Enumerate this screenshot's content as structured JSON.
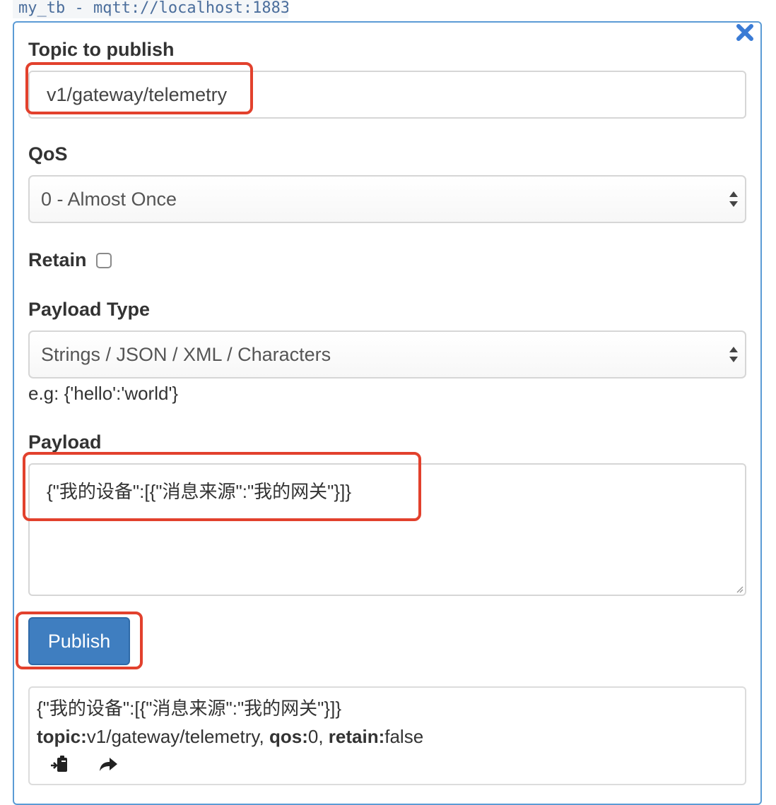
{
  "connection": {
    "label": "my_tb - mqtt://localhost:1883"
  },
  "form": {
    "topic_label": "Topic to publish",
    "topic_value": "v1/gateway/telemetry",
    "qos_label": "QoS",
    "qos_selected": "0 - Almost Once",
    "retain_label": "Retain",
    "retain_checked": false,
    "payload_type_label": "Payload Type",
    "payload_type_selected": "Strings / JSON / XML / Characters",
    "payload_type_hint": "e.g: {'hello':'world'}",
    "payload_label": "Payload",
    "payload_value": "{\"我的设备\":[{\"消息来源\":\"我的网关\"}]}",
    "publish_label": "Publish"
  },
  "result": {
    "payload": "{\"我的设备\":[{\"消息来源\":\"我的网关\"}]}",
    "topic_key": "topic:",
    "topic_value": "v1/gateway/telemetry",
    "qos_key": "qos:",
    "qos_value": "0",
    "retain_key": "retain:",
    "retain_value": "false",
    "icons": [
      "paste-icon",
      "forward-icon"
    ]
  },
  "colors": {
    "highlight": "#e2412d",
    "button": "#3f7ec0",
    "panel_border": "#5b9bd5",
    "close_icon": "#3a7bd5"
  }
}
